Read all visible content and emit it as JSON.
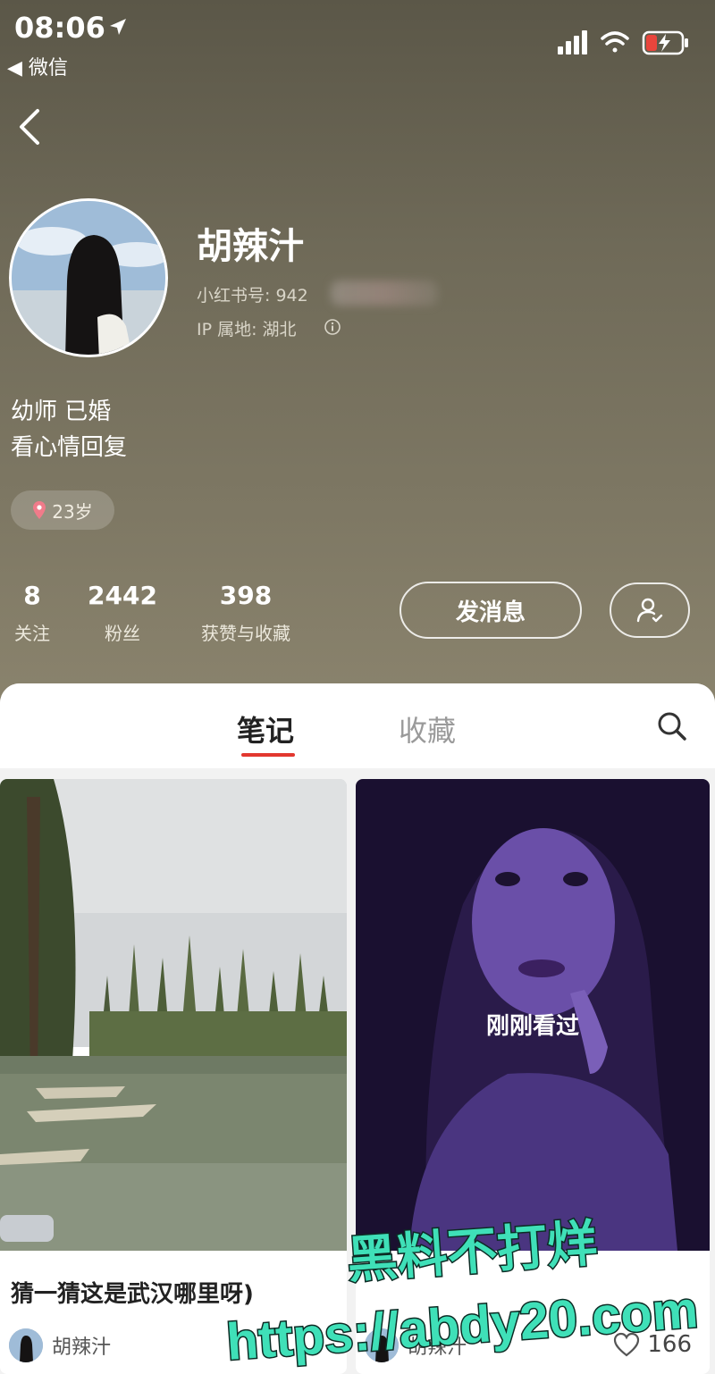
{
  "status_bar": {
    "time": "08:06",
    "back_app": "◀ 微信",
    "icons": [
      "location-arrow-icon",
      "signal-icon",
      "wifi-icon",
      "battery-charging-icon"
    ]
  },
  "profile": {
    "username": "胡辣汁",
    "user_id_label": "小红书号: 942",
    "ip_label": "IP 属地: 湖北",
    "bio": [
      "幼师 已婚",
      "看心情回复"
    ],
    "tag": "23岁",
    "stats": [
      {
        "value": "8",
        "label": "关注"
      },
      {
        "value": "2442",
        "label": "粉丝"
      },
      {
        "value": "398",
        "label": "获赞与收藏"
      }
    ],
    "message_button": "发消息"
  },
  "tabs": {
    "notes": "笔记",
    "collections": "收藏",
    "active": "笔记"
  },
  "cards": [
    {
      "title": "猜一猜这是武汉哪里呀)",
      "author": "胡辣汁"
    },
    {
      "overlay_text": "刚刚看过",
      "author": "胡辣汁",
      "likes": "166"
    }
  ],
  "watermark": {
    "line1": "黑料不打烊",
    "line2": "https://abdy20.com"
  },
  "colors": {
    "accent": "#e2372f",
    "watermark_fill": "#3fe0b8"
  }
}
